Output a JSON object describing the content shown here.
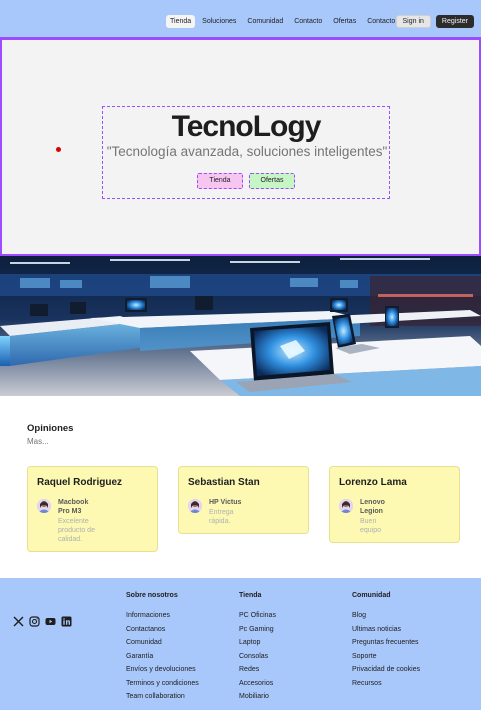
{
  "nav": {
    "links": [
      {
        "label": "Tienda",
        "active": true
      },
      {
        "label": "Soluciones",
        "active": false
      },
      {
        "label": "Comunidad",
        "active": false
      },
      {
        "label": "Contacto",
        "active": false
      },
      {
        "label": "Ofertas",
        "active": false
      },
      {
        "label": "Contacto",
        "active": false
      }
    ],
    "signin_label": "Sign in",
    "register_label": "Register"
  },
  "hero": {
    "title": "TecnoLogy",
    "subtitle": "\"Tecnología avanzada, soluciones inteligentes\"",
    "btn_tienda": "Tienda",
    "btn_ofertas": "Ofertas"
  },
  "opinions": {
    "title": "Opiniones",
    "subtitle": "Mas...",
    "cards": [
      {
        "name": "Raquel Rodriguez",
        "product": "Macbook Pro M3",
        "review": "Excelente producto de calidad."
      },
      {
        "name": "Sebastian Stan",
        "product": "HP Victus",
        "review": "Entrega rápida."
      },
      {
        "name": "Lorenzo Lama",
        "product": "Lenovo Legion",
        "review": "Buen equipo"
      }
    ]
  },
  "footer": {
    "social_icons": [
      "x-icon",
      "instagram-icon",
      "youtube-icon",
      "linkedin-icon"
    ],
    "columns": [
      {
        "heading": "Sobre nosotros",
        "items": [
          "Informaciones",
          "Contactanos",
          "Comunidad",
          "Garantía",
          "Envíos y devoluciones",
          "Terminos y condiciones",
          "Team collaboration"
        ]
      },
      {
        "heading": "Tienda",
        "items": [
          "PC Oficinas",
          "Pc Gaming",
          "Laptop",
          "Consolas",
          "Redes",
          "Accesorios",
          "Mobiliario"
        ]
      },
      {
        "heading": "Comunidad",
        "items": [
          "Blog",
          "Ultimas noticias",
          "Preguntas frecuentes",
          "Soporte",
          "Privacidad de cookies",
          "Recursos"
        ]
      }
    ]
  },
  "colors": {
    "nav_bg": "#a8c7fa",
    "accent_purple": "#9b4dff",
    "card_bg": "#fdf9b3",
    "tienda_btn": "#f7c6f0",
    "ofertas_btn": "#c6f5c6"
  }
}
